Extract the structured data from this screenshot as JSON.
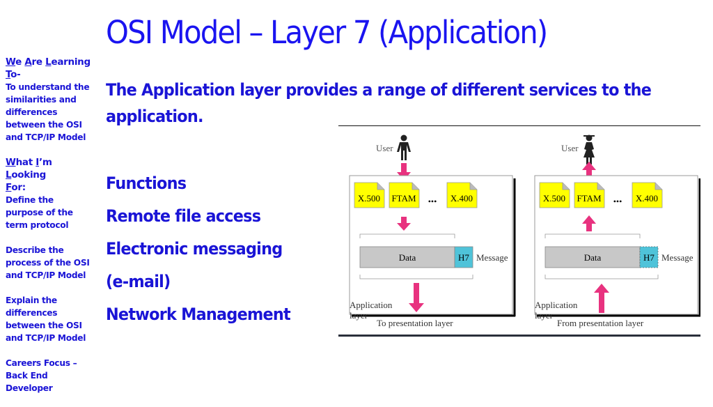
{
  "slide": {
    "title": "OSI Model – Layer 7 (Application)",
    "subtitle": "The Application layer provides a range of different services to the application.",
    "functions": {
      "heading": "Functions",
      "items": [
        "Remote file access",
        "Electronic messaging",
        "(e-mail)",
        "Network Management"
      ]
    }
  },
  "sidebar": {
    "learning": {
      "heading_parts": [
        {
          "u": "W",
          "t": "e "
        },
        {
          "u": "A",
          "t": "re "
        },
        {
          "u": "L",
          "t": "earning"
        },
        {
          "u": "T",
          "t": "o-"
        }
      ],
      "text": "To understand the similarities and differences between the OSI and TCP/IP Model"
    },
    "looking": {
      "heading_parts": [
        {
          "u": "W",
          "t": "hat "
        },
        {
          "u": "I",
          "t": "’m "
        },
        {
          "u": "L",
          "t": "ooking"
        },
        {
          "u": "F",
          "t": "or:"
        }
      ],
      "text": "Define the purpose of the term protocol"
    },
    "describe": "Describe the process of the OSI and TCP/IP Model",
    "explain": "Explain the differences between the OSI and TCP/IP Model",
    "careers": "Careers Focus – Back End Developer"
  },
  "diagram": {
    "colors": {
      "arrow": "#e8327f",
      "doc": "#ffff00",
      "data_box": "#c8c8c8",
      "header_box": "#4fc3d9"
    },
    "panels": [
      {
        "user_label": "User",
        "user_icon": "man-icon",
        "direction": "down",
        "services": [
          "X.500",
          "FTAM",
          "X.400"
        ],
        "ellipsis": "•••",
        "data_label": "Data",
        "header_label": "H7",
        "message_label": "Message",
        "layer_label": "Application layer",
        "bottom_label": "To presentation layer"
      },
      {
        "user_label": "User",
        "user_icon": "woman-icon",
        "direction": "up",
        "services": [
          "X.500",
          "FTAM",
          "X.400"
        ],
        "ellipsis": "•••",
        "data_label": "Data",
        "header_label": "H7",
        "message_label": "Message",
        "layer_label": "Application layer",
        "bottom_label": "From presentation layer"
      }
    ]
  }
}
